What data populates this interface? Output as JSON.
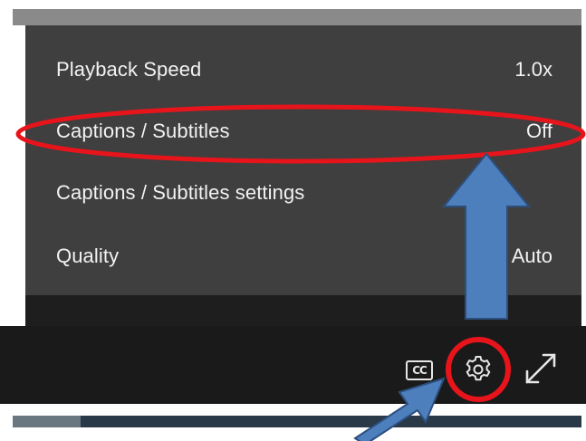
{
  "settings_menu": {
    "items": [
      {
        "label": "Playback Speed",
        "value": "1.0x"
      },
      {
        "label": "Captions / Subtitles",
        "value": "Off"
      },
      {
        "label": "Captions / Subtitles settings",
        "value": ""
      },
      {
        "label": "Quality",
        "value": "Auto"
      }
    ]
  },
  "controls": {
    "cc_label": "CC",
    "cc_icon": "closed-captions-icon",
    "settings_icon": "gear-icon",
    "fullscreen_icon": "fullscreen-expand-icon"
  },
  "progress": {
    "played_fraction": 0.12
  },
  "annotations": {
    "highlight_color": "#e8141b",
    "arrow_color": "#4e7fbd",
    "arrow_outline": "#2c4f7e"
  },
  "colors": {
    "menu_background": "#3f3f3f",
    "control_bar": "#1a1a1a",
    "menu_text": "#f2f2f2"
  }
}
